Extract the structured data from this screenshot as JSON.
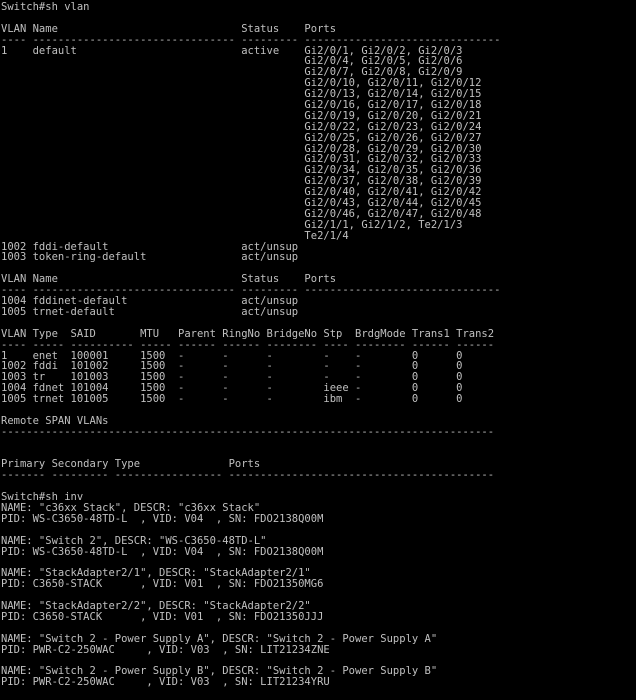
{
  "terminal": {
    "lines": [
      "Switch#sh vlan",
      "",
      "VLAN Name                             Status    Ports",
      "---- -------------------------------- --------- -------------------------------",
      "1    default                          active    Gi2/0/1, Gi2/0/2, Gi2/0/3",
      "                                                Gi2/0/4, Gi2/0/5, Gi2/0/6",
      "                                                Gi2/0/7, Gi2/0/8, Gi2/0/9",
      "                                                Gi2/0/10, Gi2/0/11, Gi2/0/12",
      "                                                Gi2/0/13, Gi2/0/14, Gi2/0/15",
      "                                                Gi2/0/16, Gi2/0/17, Gi2/0/18",
      "                                                Gi2/0/19, Gi2/0/20, Gi2/0/21",
      "                                                Gi2/0/22, Gi2/0/23, Gi2/0/24",
      "                                                Gi2/0/25, Gi2/0/26, Gi2/0/27",
      "                                                Gi2/0/28, Gi2/0/29, Gi2/0/30",
      "                                                Gi2/0/31, Gi2/0/32, Gi2/0/33",
      "                                                Gi2/0/34, Gi2/0/35, Gi2/0/36",
      "                                                Gi2/0/37, Gi2/0/38, Gi2/0/39",
      "                                                Gi2/0/40, Gi2/0/41, Gi2/0/42",
      "                                                Gi2/0/43, Gi2/0/44, Gi2/0/45",
      "                                                Gi2/0/46, Gi2/0/47, Gi2/0/48",
      "                                                Gi2/1/1, Gi2/1/2, Te2/1/3",
      "                                                Te2/1/4",
      "1002 fddi-default                     act/unsup",
      "1003 token-ring-default               act/unsup",
      "",
      "VLAN Name                             Status    Ports",
      "---- -------------------------------- --------- -------------------------------",
      "1004 fddinet-default                  act/unsup",
      "1005 trnet-default                    act/unsup",
      "",
      "VLAN Type  SAID       MTU   Parent RingNo BridgeNo Stp  BrdgMode Trans1 Trans2",
      "---- ----- ---------- ----- ------ ------ -------- ---- -------- ------ ------",
      "1    enet  100001     1500  -      -      -        -    -        0      0",
      "1002 fddi  101002     1500  -      -      -        -    -        0      0",
      "1003 tr    101003     1500  -      -      -        -    -        0      0",
      "1004 fdnet 101004     1500  -      -      -        ieee -        0      0",
      "1005 trnet 101005     1500  -      -      -        ibm  -        0      0",
      "",
      "Remote SPAN VLANs",
      "------------------------------------------------------------------------------",
      "",
      "",
      "Primary Secondary Type              Ports",
      "------- --------- ----------------- ------------------------------------------",
      "",
      "Switch#sh inv",
      "NAME: \"c36xx Stack\", DESCR: \"c36xx Stack\"",
      "PID: WS-C3650-48TD-L  , VID: V04  , SN: FDO2138Q00M",
      "",
      "NAME: \"Switch 2\", DESCR: \"WS-C3650-48TD-L\"",
      "PID: WS-C3650-48TD-L  , VID: V04  , SN: FDO2138Q00M",
      "",
      "NAME: \"StackAdapter2/1\", DESCR: \"StackAdapter2/1\"",
      "PID: C3650-STACK      , VID: V01  , SN: FDO21350MG6",
      "",
      "NAME: \"StackAdapter2/2\", DESCR: \"StackAdapter2/2\"",
      "PID: C3650-STACK      , VID: V01  , SN: FDO21350JJJ",
      "",
      "NAME: \"Switch 2 - Power Supply A\", DESCR: \"Switch 2 - Power Supply A\"",
      "PID: PWR-C2-250WAC     , VID: V03  , SN: LIT21234ZNE",
      "",
      "NAME: \"Switch 2 - Power Supply B\", DESCR: \"Switch 2 - Power Supply B\"",
      "PID: PWR-C2-250WAC     , VID: V03  , SN: LIT21234YRU"
    ]
  }
}
